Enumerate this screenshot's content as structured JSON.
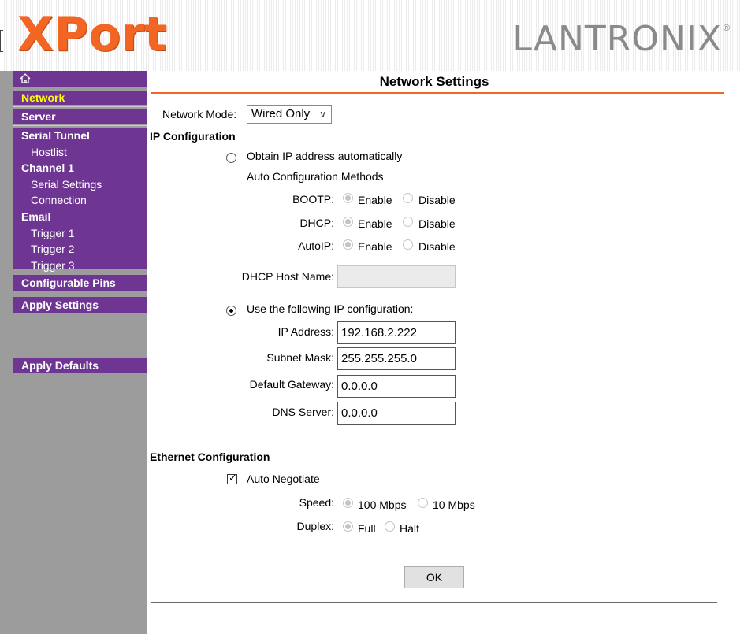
{
  "header": {
    "product_logo": "XPort",
    "brand_logo": "LANTRONIX"
  },
  "sidebar": {
    "home_icon": "home-icon",
    "items": {
      "network": "Network",
      "server": "Server",
      "serial_tunnel": "Serial Tunnel",
      "hostlist": "Hostlist",
      "channel_1": "Channel 1",
      "serial_settings": "Serial Settings",
      "connection": "Connection",
      "email": "Email",
      "trigger_1": "Trigger 1",
      "trigger_2": "Trigger 2",
      "trigger_3": "Trigger 3",
      "configurable_pins": "Configurable Pins",
      "apply_settings": "Apply Settings",
      "apply_defaults": "Apply Defaults"
    },
    "active_item_color": "#ffff00",
    "item_bg_color": "#6e3592"
  },
  "page": {
    "title": "Network Settings",
    "accent_color": "#f26522"
  },
  "network_mode": {
    "label": "Network Mode:",
    "value": "Wired Only"
  },
  "ip_config": {
    "heading": "IP Configuration",
    "obtain_auto_label": "Obtain IP address automatically",
    "obtain_auto_selected": false,
    "auto_methods_label": "Auto Configuration Methods",
    "bootp_label": "BOOTP:",
    "dhcp_label": "DHCP:",
    "autoip_label": "AutoIP:",
    "enable_label": "Enable",
    "disable_label": "Disable",
    "dhcp_hostname_label": "DHCP Host Name:",
    "dhcp_hostname_value": "",
    "use_following_label": "Use the following IP configuration:",
    "use_following_selected": true,
    "ip_address_label": "IP Address:",
    "ip_address_value": "192.168.2.222",
    "subnet_mask_label": "Subnet Mask:",
    "subnet_mask_value": "255.255.255.0",
    "gateway_label": "Default Gateway:",
    "gateway_value": "0.0.0.0",
    "dns_label": "DNS Server:",
    "dns_value": "0.0.0.0"
  },
  "ethernet": {
    "heading": "Ethernet Configuration",
    "auto_negotiate_label": "Auto Negotiate",
    "auto_negotiate_checked": true,
    "speed_label": "Speed:",
    "speed_100": "100 Mbps",
    "speed_10": "10 Mbps",
    "duplex_label": "Duplex:",
    "duplex_full": "Full",
    "duplex_half": "Half"
  },
  "actions": {
    "ok_label": "OK"
  }
}
